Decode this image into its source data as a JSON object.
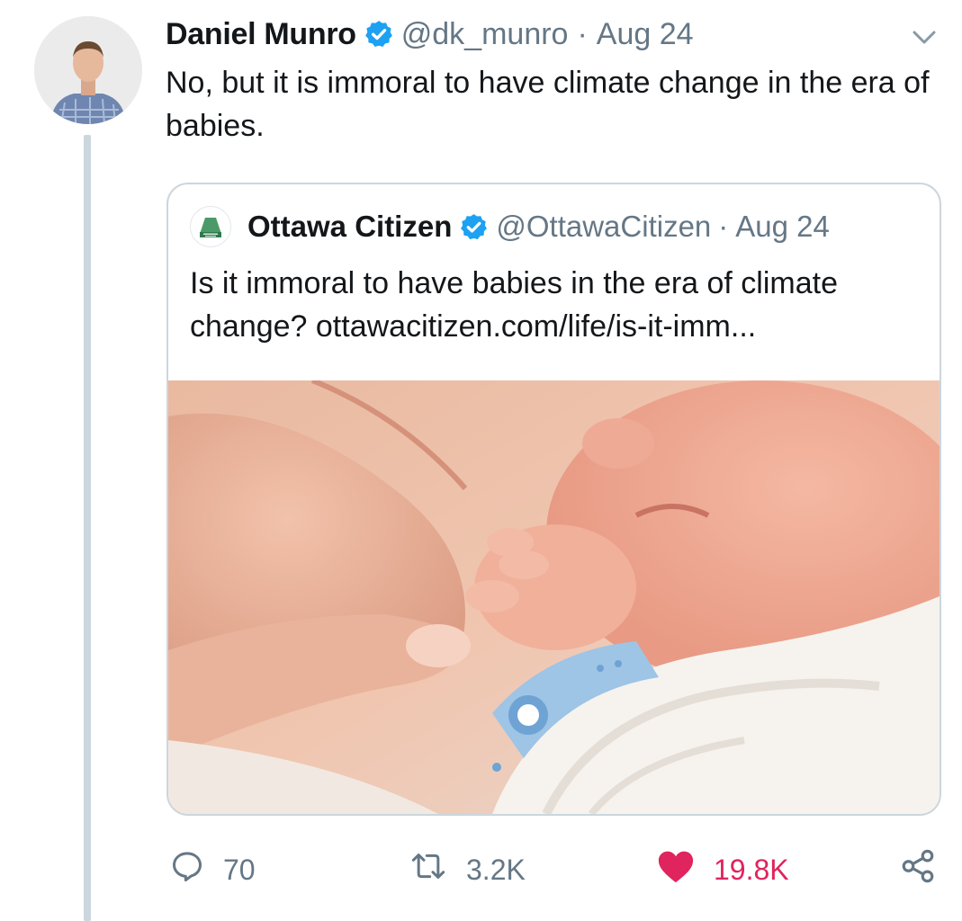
{
  "tweet": {
    "author_name": "Daniel Munro",
    "author_handle": "@dk_munro",
    "separator": "·",
    "date": "Aug 24",
    "text": "No, but it is immoral to have climate change in the era of babies.",
    "avatar_icon": "person-avatar-icon",
    "verified_icon": "verified-badge-icon",
    "menu_icon": "chevron-down-icon"
  },
  "quoted_tweet": {
    "author_name": "Ottawa Citizen",
    "author_handle": "@OttawaCitizen",
    "separator": "·",
    "date": "Aug 24",
    "text": "Is it immoral to have babies in the era of climate change? ottawacitizen.com/life/is-it-imm...",
    "logo_icon": "ottawa-citizen-logo-icon",
    "image_icon": "baby-hand-photo"
  },
  "actions": {
    "reply": {
      "icon": "reply-bubble-icon",
      "count": "70"
    },
    "retweet": {
      "icon": "retweet-icon",
      "count": "3.2K"
    },
    "like": {
      "icon": "heart-icon",
      "count": "19.8K"
    },
    "share": {
      "icon": "share-icon",
      "count": ""
    }
  },
  "colors": {
    "verified": "#1da1f2",
    "muted_text": "#657786",
    "like_active": "#e0245e",
    "border": "#ccd6dd"
  }
}
